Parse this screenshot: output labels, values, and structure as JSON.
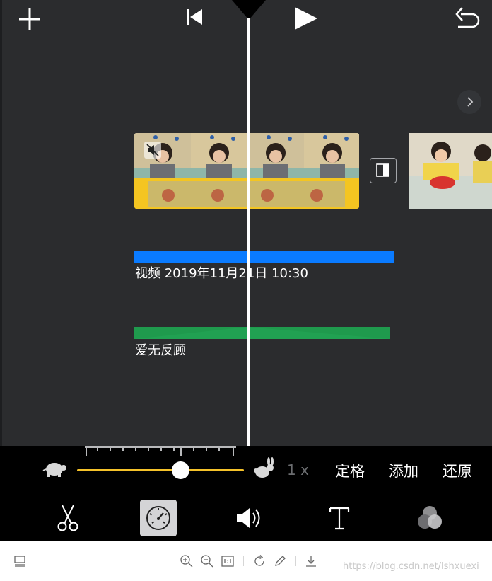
{
  "editor": {
    "title_clip": {
      "label": "视频 2019年11月21日 10:30",
      "color": "#0a7bff"
    },
    "audio_clip": {
      "label": "爱无反顾",
      "color": "#1f9a4d"
    }
  },
  "topbar": {
    "add_icon": "plus-icon",
    "rewind_icon": "skip-to-start-icon",
    "play_icon": "play-icon",
    "undo_icon": "undo-icon"
  },
  "speed": {
    "slow_icon": "turtle-icon",
    "fast_icon": "rabbit-icon",
    "value_label": "1 x",
    "slider_fraction": 0.62,
    "slider_color": "#f5c22a",
    "actions": {
      "freeze": "定格",
      "add": "添加",
      "reset": "还原"
    }
  },
  "tools": [
    {
      "name": "cut",
      "icon": "scissors-icon",
      "selected": false
    },
    {
      "name": "speed",
      "icon": "speedometer-icon",
      "selected": true
    },
    {
      "name": "volume",
      "icon": "speaker-icon",
      "selected": false
    },
    {
      "name": "titles",
      "icon": "text-icon",
      "selected": false
    },
    {
      "name": "filters",
      "icon": "color-circles-icon",
      "selected": false
    }
  ],
  "viewer_bar": {
    "icons": [
      "layout-icon",
      "zoom-in-icon",
      "zoom-out-icon",
      "actual-size-icon",
      "rotate-icon",
      "edit-icon",
      "download-icon"
    ],
    "watermark": "https://blog.csdn.net/lshxuexi"
  }
}
